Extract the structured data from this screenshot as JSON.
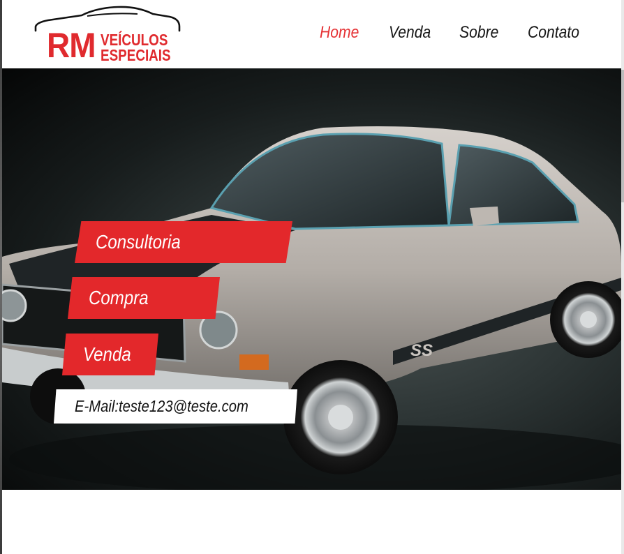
{
  "brand": {
    "logo_rm": "RM",
    "logo_line1": "VEÍCULOS",
    "logo_line2": "ESPECIAIS",
    "color": "#e02a2e"
  },
  "nav": {
    "items": [
      {
        "label": "Home",
        "active": true
      },
      {
        "label": "Venda",
        "active": false
      },
      {
        "label": "Sobre",
        "active": false
      },
      {
        "label": "Contato",
        "active": false
      }
    ]
  },
  "hero": {
    "image": "classic-silver-coupe-with-black-stripe",
    "tags": {
      "consultoria": "Consultoria",
      "compra": "Compra",
      "venda": "Venda"
    },
    "email": "E-Mail:teste123@teste.com"
  },
  "colors": {
    "accent": "#e3282b",
    "nav_active": "#e53033",
    "text": "#151515"
  }
}
